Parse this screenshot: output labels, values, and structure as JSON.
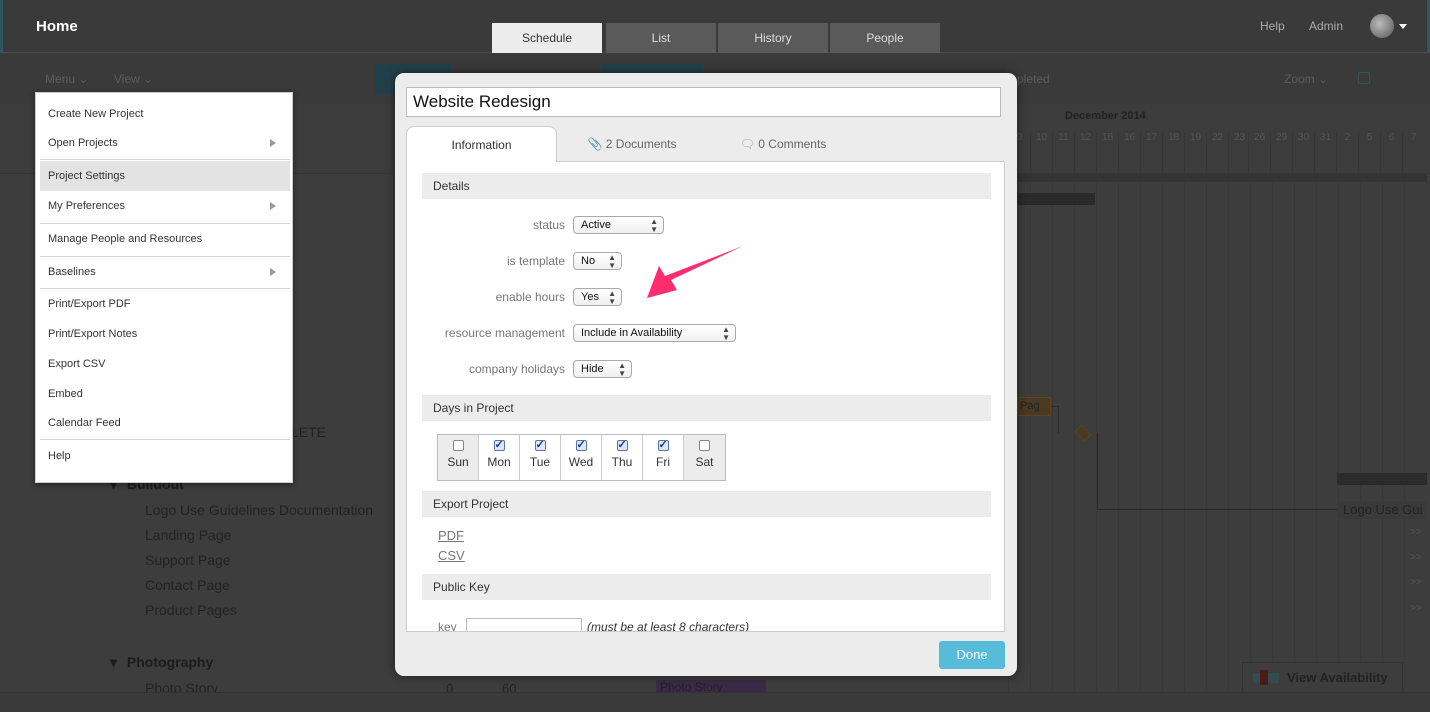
{
  "header": {
    "title": "Home",
    "tabs": [
      {
        "label": "Schedule",
        "active": true
      },
      {
        "label": "List"
      },
      {
        "label": "History"
      },
      {
        "label": "People"
      }
    ],
    "help": "Help",
    "admin": "Admin"
  },
  "toolbar": {
    "menu": "Menu",
    "view": "View",
    "completed_partial": "pleted",
    "zoom": "Zoom"
  },
  "gantt": {
    "month": "December 2014",
    "days": [
      "9",
      "10",
      "11",
      "12",
      "15",
      "16",
      "17",
      "18",
      "19",
      "22",
      "23",
      "26",
      "29",
      "30",
      "31",
      "2",
      "5",
      "6",
      "7"
    ],
    "bar_page": "Pag",
    "bar_logo": "Logo Use Gui",
    "more": ">>"
  },
  "tasks": {
    "complete_partial": "LETE",
    "group1": "Buildout",
    "items": [
      "Logo Use Guidelines Documentation",
      "Landing Page",
      "Support Page",
      "Contact Page",
      "Product Pages"
    ],
    "group2": "Photography",
    "photo_story": "Photo Story",
    "photo_est": "0",
    "photo_dur": "60",
    "photo_bar": "Photo Story"
  },
  "menu": {
    "items": [
      "Create New Project",
      "Open Projects",
      "Project Settings",
      "My Preferences",
      "Manage People and Resources",
      "Baselines",
      "Print/Export PDF",
      "Print/Export Notes",
      "Export CSV",
      "Embed",
      "Calendar Feed",
      "Help"
    ],
    "selected": "Project Settings"
  },
  "dialog": {
    "title": "Website Redesign",
    "tabs": {
      "info": "Information",
      "docs": "2 Documents",
      "comments": "0 Comments"
    },
    "details": {
      "heading": "Details",
      "fields": [
        {
          "label": "status",
          "value": "Active"
        },
        {
          "label": "is template",
          "value": "No"
        },
        {
          "label": "enable hours",
          "value": "Yes"
        },
        {
          "label": "resource management",
          "value": "Include in Availability"
        },
        {
          "label": "company holidays",
          "value": "Hide"
        }
      ]
    },
    "days": {
      "heading": "Days in Project",
      "list": [
        {
          "d": "Sun",
          "on": false
        },
        {
          "d": "Mon",
          "on": true
        },
        {
          "d": "Tue",
          "on": true
        },
        {
          "d": "Wed",
          "on": true
        },
        {
          "d": "Thu",
          "on": true
        },
        {
          "d": "Fri",
          "on": true
        },
        {
          "d": "Sat",
          "on": false
        }
      ]
    },
    "export": {
      "heading": "Export Project",
      "pdf": "PDF",
      "csv": "CSV"
    },
    "public_key": {
      "heading": "Public Key",
      "label": "key",
      "value": "",
      "hint": "(must be at least 8 characters)"
    },
    "done": "Done"
  },
  "footer": {
    "view_availability": "View Availability"
  },
  "colors": {
    "accent": "#56bcd9",
    "arrow": "#ff2d6f",
    "overlay": "#3d3d3d"
  }
}
